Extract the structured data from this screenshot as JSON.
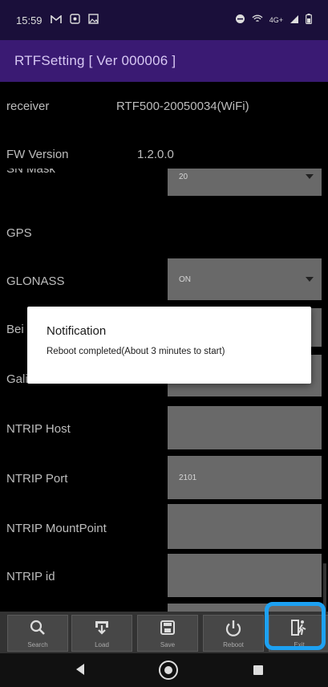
{
  "status_bar": {
    "time": "15:59",
    "network": "4G+"
  },
  "app": {
    "title": "RTFSetting  [ Ver 000006 ]"
  },
  "rows": {
    "receiver": {
      "label": "receiver",
      "value": "RTF500-20050034(WiFi)"
    },
    "fw_version": {
      "label": "FW Version",
      "value": "1.2.0.0"
    },
    "sn_mask": {
      "label": "SN Mask",
      "value": "20"
    },
    "gps": {
      "label": "GPS"
    },
    "glonass": {
      "label": "GLONASS",
      "value": "ON"
    },
    "beidou": {
      "label": "Bei"
    },
    "galileo": {
      "label": "Galileo"
    },
    "ntrip_host": {
      "label": "NTRIP Host",
      "value": ""
    },
    "ntrip_port": {
      "label": "NTRIP Port",
      "value": "2101"
    },
    "ntrip_mountpoint": {
      "label": "NTRIP MountPoint",
      "value": ""
    },
    "ntrip_id": {
      "label": "NTRIP id",
      "value": ""
    }
  },
  "dialog": {
    "title": "Notification",
    "message": "Reboot completed(About 3 minutes to start)"
  },
  "toolbar": {
    "search": "Search",
    "load": "Load",
    "save": "Save",
    "reboot": "Reboot",
    "exit": "Exit"
  },
  "colors": {
    "status_bar": "#1a0f3a",
    "title_bar": "#3a1a73",
    "highlight": "#1da1f2"
  }
}
